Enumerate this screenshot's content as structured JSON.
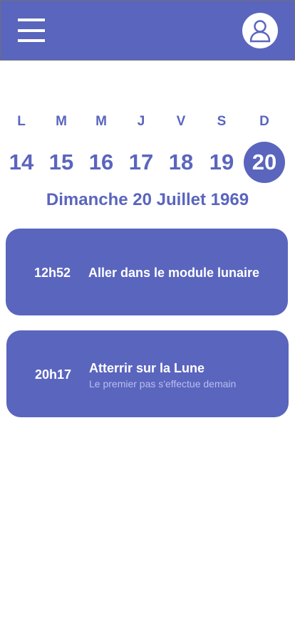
{
  "header": {
    "menu_icon": "hamburger-menu-icon",
    "profile_icon": "user-profile-icon"
  },
  "calendar": {
    "weekdays": [
      "L",
      "M",
      "M",
      "J",
      "V",
      "S",
      "D"
    ],
    "days": [
      "14",
      "15",
      "16",
      "17",
      "18",
      "19",
      "20"
    ],
    "selected_day": "20",
    "selected_date_label": "Dimanche 20 Juillet 1969"
  },
  "events": [
    {
      "time": "12h52",
      "title": "Aller dans le module lunaire"
    },
    {
      "time": "20h17",
      "title": "Atterrir sur la Lune",
      "subtitle": "Le premier pas s'effectue demain"
    }
  ],
  "colors": {
    "primary": "#5a65be",
    "subtitle": "#b9bff0",
    "background": "#ffffff"
  }
}
